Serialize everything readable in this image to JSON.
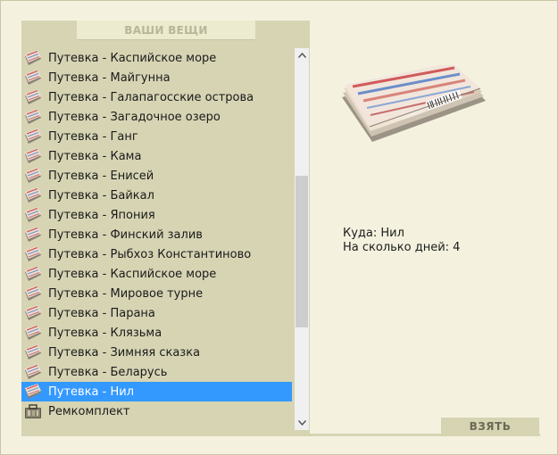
{
  "inventory": {
    "header": "ВАШИ ВЕЩИ",
    "items": [
      {
        "label": "Путевка - Каспийское море",
        "icon": "ticket-icon"
      },
      {
        "label": "Путевка - Майгунна",
        "icon": "ticket-icon"
      },
      {
        "label": "Путевка - Галапагосские острова",
        "icon": "ticket-icon"
      },
      {
        "label": "Путевка - Загадочное озеро",
        "icon": "ticket-icon"
      },
      {
        "label": "Путевка - Ганг",
        "icon": "ticket-icon"
      },
      {
        "label": "Путевка - Кама",
        "icon": "ticket-icon"
      },
      {
        "label": "Путевка - Енисей",
        "icon": "ticket-icon"
      },
      {
        "label": "Путевка - Байкал",
        "icon": "ticket-icon"
      },
      {
        "label": "Путевка - Япония",
        "icon": "ticket-icon"
      },
      {
        "label": "Путевка - Финский залив",
        "icon": "ticket-icon"
      },
      {
        "label": "Путевка - Рыбхоз Константиново",
        "icon": "ticket-icon"
      },
      {
        "label": "Путевка - Каспийское море",
        "icon": "ticket-icon"
      },
      {
        "label": "Путевка - Мировое турне",
        "icon": "ticket-icon"
      },
      {
        "label": "Путевка - Парана",
        "icon": "ticket-icon"
      },
      {
        "label": "Путевка - Клязьма",
        "icon": "ticket-icon"
      },
      {
        "label": "Путевка - Зимняя сказка",
        "icon": "ticket-icon"
      },
      {
        "label": "Путевка - Беларусь",
        "icon": "ticket-icon"
      },
      {
        "label": "Путевка - Нил",
        "icon": "ticket-icon",
        "selected": true
      },
      {
        "label": "Ремкомплект",
        "icon": "repair-kit-icon"
      }
    ],
    "selected_index": 17,
    "scroll_position": 0.56
  },
  "details": {
    "destination_line": "Куда: Нил",
    "days_line": "На сколько дней: 4"
  },
  "actions": {
    "take_label": "ВЗЯТЬ"
  },
  "colors": {
    "background": "#f4f2df",
    "panel": "#d6d4b3",
    "selection": "#3399ff"
  }
}
